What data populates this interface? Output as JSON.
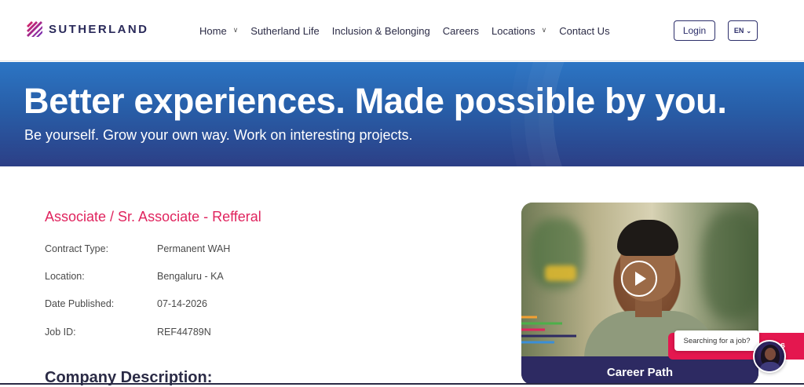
{
  "brand": {
    "name": "SUTHERLAND",
    "colors": {
      "accent": "#e0245e",
      "navy": "#2d2f6b"
    }
  },
  "nav": {
    "items": [
      {
        "label": "Home",
        "has_dropdown": true
      },
      {
        "label": "Sutherland Life",
        "has_dropdown": false
      },
      {
        "label": "Inclusion & Belonging",
        "has_dropdown": false
      },
      {
        "label": "Careers",
        "has_dropdown": false
      },
      {
        "label": "Locations",
        "has_dropdown": true
      },
      {
        "label": "Contact Us",
        "has_dropdown": false
      }
    ],
    "login_label": "Login",
    "language": "EN"
  },
  "hero": {
    "title_part1": "Better ",
    "title_bold1": "experiences.",
    "title_part2": " Made possible by ",
    "title_bold2": "you.",
    "subtitle": "Be yourself. Grow your own way. Work on interesting projects."
  },
  "job": {
    "title": "Associate / Sr. Associate - Refferal",
    "details": [
      {
        "label": "Contract Type:",
        "value": "Permanent WAH"
      },
      {
        "label": "Location:",
        "value": "Bengaluru - KA"
      },
      {
        "label": "Date Published:",
        "value": "07-14-2026"
      },
      {
        "label": "Job ID:",
        "value": "REF44789N"
      }
    ],
    "section_heading": "Company Description:"
  },
  "video": {
    "caption": "Career Path",
    "icon": "play-icon"
  },
  "chat": {
    "bubble_text": "Searching for a job?",
    "tab_text": "s"
  }
}
